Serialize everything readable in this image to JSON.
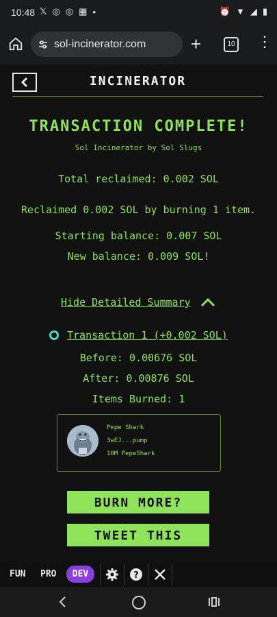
{
  "status_bar": {
    "time": "10:48",
    "left_icons": [
      "x-logo-icon",
      "circle-c-icon",
      "circle-c-icon",
      "qr-icon",
      "dot-icon"
    ],
    "right_icons": [
      "alarm-icon",
      "wifi-icon",
      "signal-icon",
      "battery-icon"
    ]
  },
  "browser": {
    "url": "sol-incinerator.com",
    "tab_count": "10"
  },
  "header": {
    "title": "INCINERATOR"
  },
  "result": {
    "title": "TRANSACTION COMPLETE!",
    "byline": "Sol Incinerator by Sol Slugs",
    "total_reclaimed": "Total reclaimed: 0.002 SOL",
    "reclaimed_detail": "Reclaimed 0.002 SOL by burning 1 item.",
    "starting_balance": "Starting balance: 0.007 SOL",
    "new_balance": "New balance: 0.009 SOL!"
  },
  "summary": {
    "toggle_label": "Hide Detailed Summary",
    "transaction_label": "Transaction 1 (+0.002 SOL)",
    "before": "Before: 0.00676 SOL",
    "after": "After: 0.00876 SOL",
    "items_burned": "Items Burned: 1"
  },
  "item": {
    "name": "Pepe Shark",
    "mint": "3wEJ...pump",
    "amount": "10M PepeShark"
  },
  "actions": {
    "burn_more": "BURN MORE?",
    "tweet": "TWEET THIS"
  },
  "mode_bar": {
    "fun": "FUN",
    "pro": "PRO",
    "dev": "DEV"
  },
  "colors": {
    "accent_green": "#8fe35a",
    "background": "#121212",
    "dev_purple": "#8a3ee0",
    "solana_teal": "#45d6c6"
  }
}
